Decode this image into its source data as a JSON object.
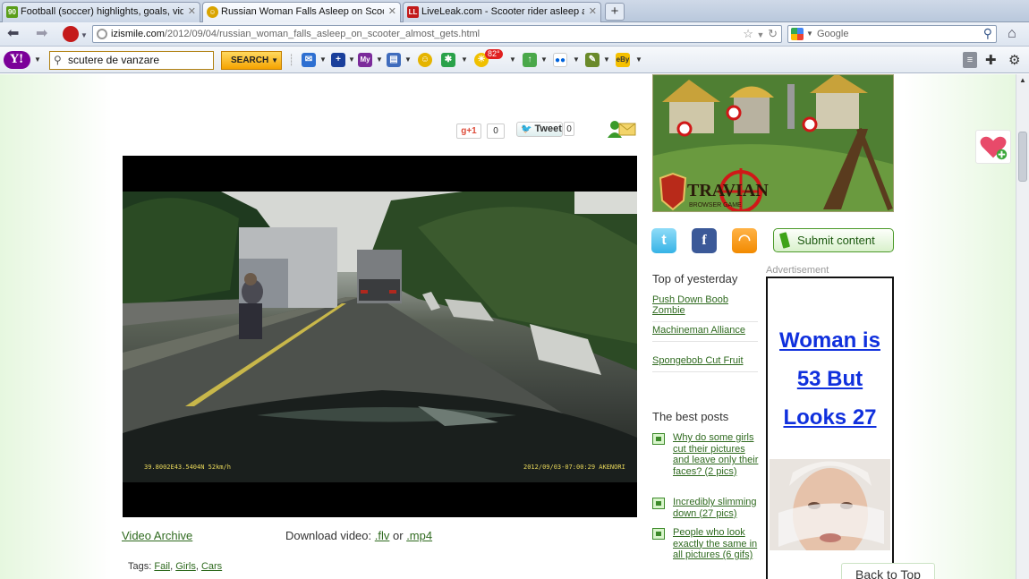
{
  "browser": {
    "tabs": [
      {
        "title": "Football (soccer) highlights, goals, videos...",
        "favicon": "football-icon",
        "active": false
      },
      {
        "title": "Russian Woman Falls Asleep on Scooter, ...",
        "favicon": "izismile-icon",
        "active": true
      },
      {
        "title": "LiveLeak.com - Scooter rider asleep and ...",
        "favicon": "liveleak-icon",
        "active": false
      }
    ],
    "new_tab": "+",
    "url_host": "izismile.com",
    "url_path": "/2012/09/04/russian_woman_falls_asleep_on_scooter_almost_gets.html",
    "search_placeholder": "Google"
  },
  "yahoo_toolbar": {
    "logo": "Y!",
    "search_value": "scutere de vanzare",
    "search_button": "SEARCH",
    "notification_count": "82°"
  },
  "share": {
    "gplus_label": "+1",
    "gplus_count": "0",
    "tweet_label": "Tweet",
    "tweet_count": "0"
  },
  "video": {
    "osd_left": "39.8002E43.5404N  52km/h",
    "osd_right": "2012/09/03-07:00:29  AKENORI"
  },
  "below_video": {
    "archive_link": "Video Archive",
    "download_label": "Download video:",
    "flv": ".flv",
    "or": "or",
    "mp4": ".mp4",
    "tags_label": "Tags:",
    "tags": [
      "Fail",
      "Girls",
      "Cars"
    ]
  },
  "banner": {
    "brand": "TRAVIAN",
    "sub": "BROWSER GAME"
  },
  "sidebar": {
    "submit_label": "Submit content",
    "top_yesterday_title": "Top of yesterday",
    "top_yesterday": [
      "Push Down Boob Zombie",
      "Machineman Alliance",
      "Spongebob Cut Fruit"
    ],
    "best_posts_title": "The best posts",
    "best_posts": [
      "Why do some girls cut their pictures and leave only their faces? (2 pics)",
      "Incredibly slimming down (27 pics)",
      "People who look exactly the same in all pictures (6 gifs)"
    ]
  },
  "ad": {
    "label": "Advertisement",
    "headline": [
      "Woman is",
      "53 But",
      "Looks 27"
    ]
  },
  "back_to_top": "Back to Top",
  "colors": {
    "link_green": "#2f6a1f",
    "ad_blue": "#1030dd",
    "yahoo_purple": "#7b0099"
  }
}
